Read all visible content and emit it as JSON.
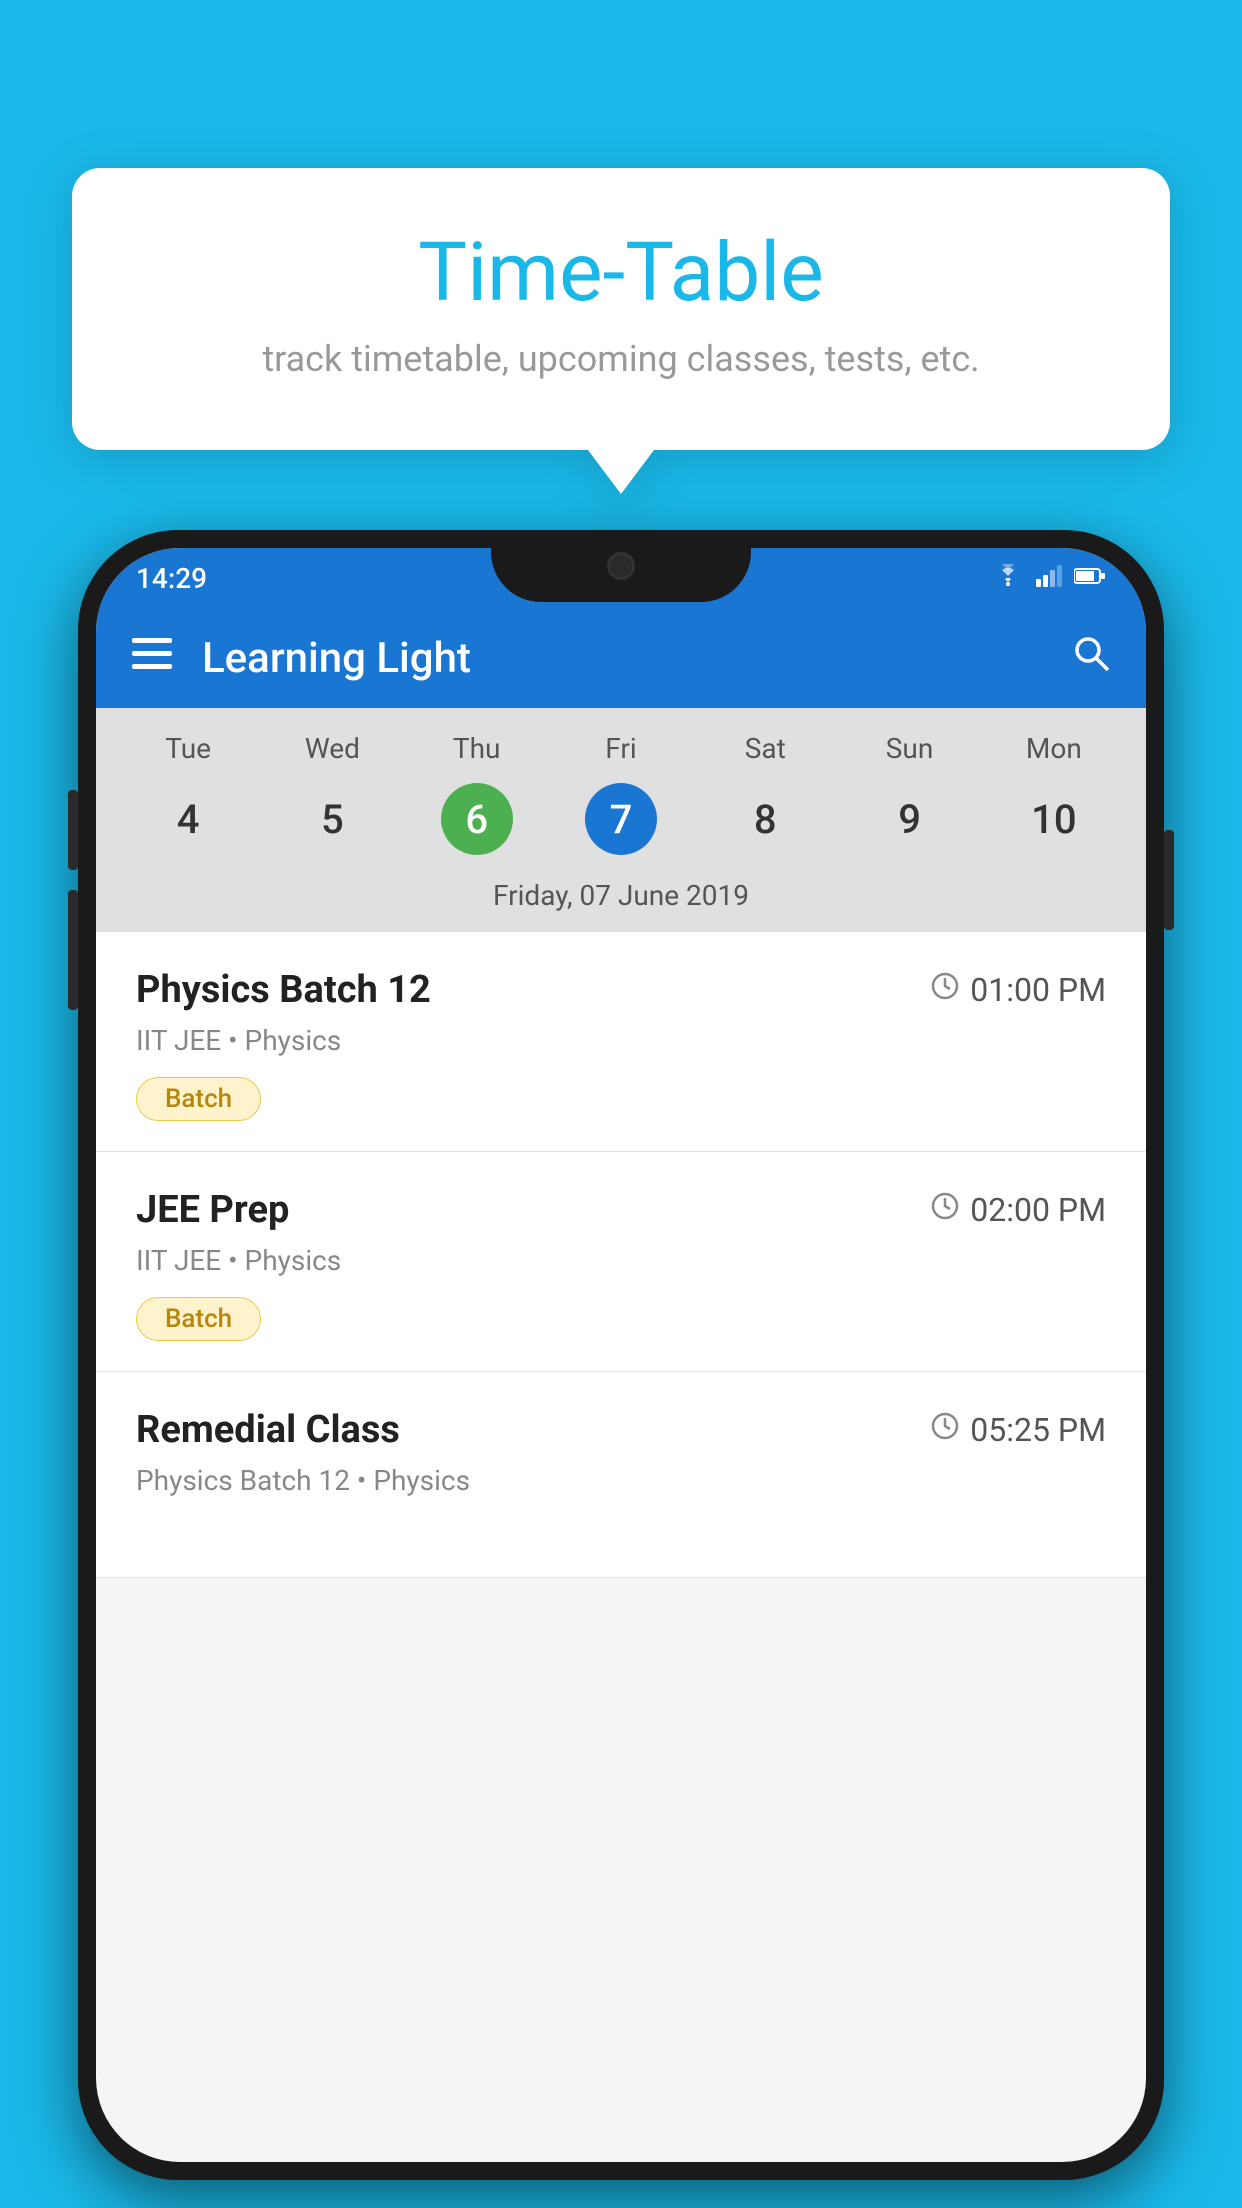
{
  "background_color": "#1ab8e8",
  "tooltip": {
    "title": "Time-Table",
    "subtitle": "track timetable, upcoming classes, tests, etc."
  },
  "phone": {
    "status_bar": {
      "time": "14:29",
      "wifi_icon": "wifi",
      "signal_icon": "signal",
      "battery_icon": "battery"
    },
    "app_bar": {
      "title": "Learning Light",
      "menu_icon": "≡",
      "search_icon": "🔍"
    },
    "calendar": {
      "days": [
        "Tue",
        "Wed",
        "Thu",
        "Fri",
        "Sat",
        "Sun",
        "Mon"
      ],
      "dates": [
        "4",
        "5",
        "6",
        "7",
        "8",
        "9",
        "10"
      ],
      "today_index": 2,
      "selected_index": 3,
      "selected_date_label": "Friday, 07 June 2019"
    },
    "schedule": [
      {
        "title": "Physics Batch 12",
        "time": "01:00 PM",
        "subtitle": "IIT JEE • Physics",
        "badge": "Batch"
      },
      {
        "title": "JEE Prep",
        "time": "02:00 PM",
        "subtitle": "IIT JEE • Physics",
        "badge": "Batch"
      },
      {
        "title": "Remedial Class",
        "time": "05:25 PM",
        "subtitle": "Physics Batch 12 • Physics",
        "badge": ""
      }
    ]
  }
}
